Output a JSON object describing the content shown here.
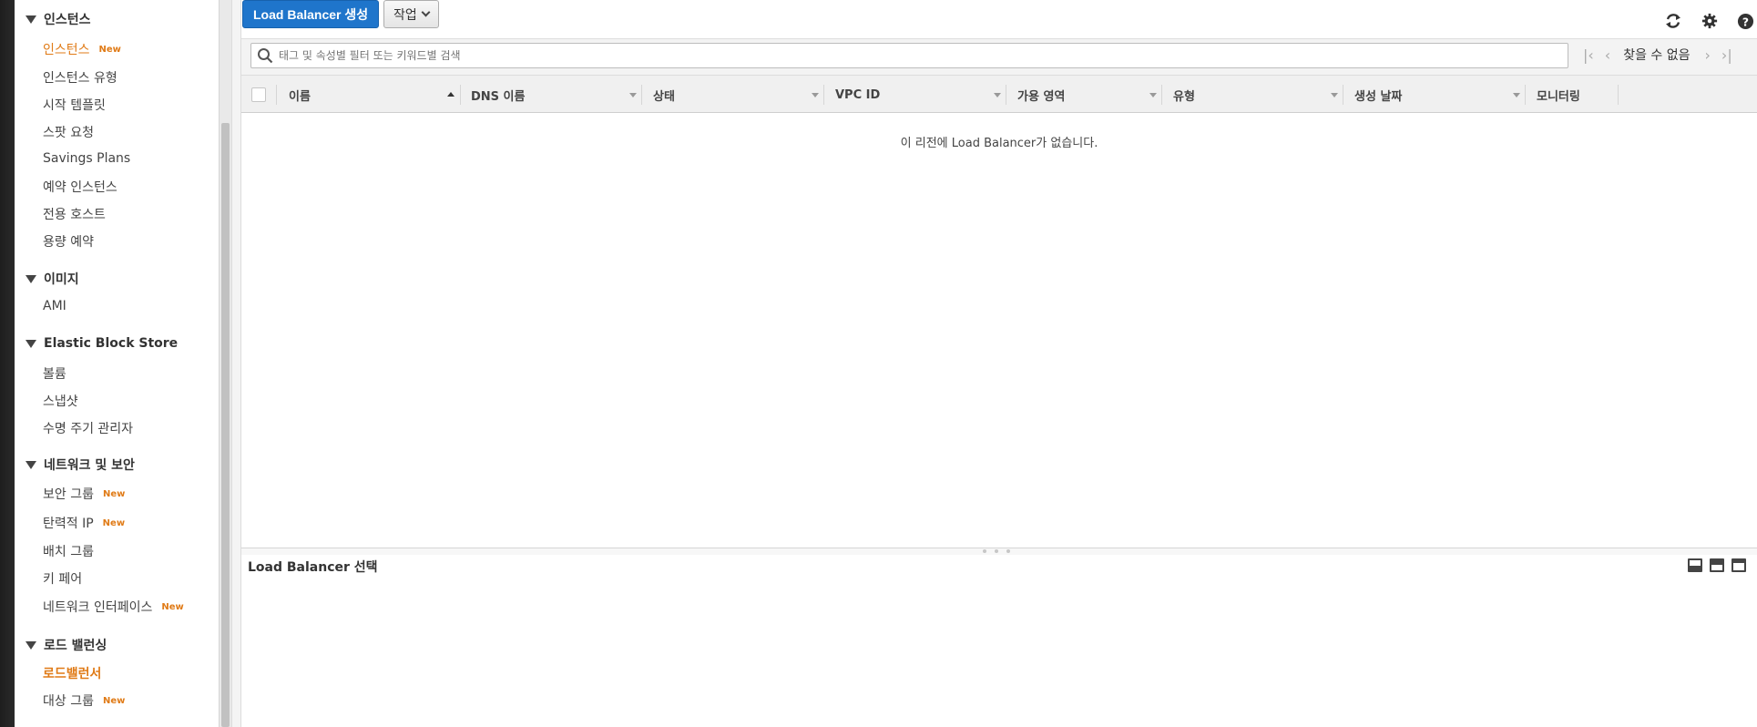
{
  "sidebar": {
    "sections": [
      {
        "title": "인스턴스",
        "items": [
          {
            "label": "인스턴스",
            "badge": "New",
            "state": "active"
          },
          {
            "label": "인스턴스 유형"
          },
          {
            "label": "시작 템플릿"
          },
          {
            "label": "스팟 요청"
          },
          {
            "label": "Savings Plans"
          },
          {
            "label": "예약 인스턴스"
          },
          {
            "label": "전용 호스트"
          },
          {
            "label": "용량 예약"
          }
        ]
      },
      {
        "title": "이미지",
        "items": [
          {
            "label": "AMI"
          }
        ]
      },
      {
        "title": "Elastic Block Store",
        "items": [
          {
            "label": "볼륨"
          },
          {
            "label": "스냅샷"
          },
          {
            "label": "수명 주기 관리자"
          }
        ]
      },
      {
        "title": "네트워크 및 보안",
        "items": [
          {
            "label": "보안 그룹",
            "badge": "New"
          },
          {
            "label": "탄력적 IP",
            "badge": "New"
          },
          {
            "label": "배치 그룹"
          },
          {
            "label": "키 페어"
          },
          {
            "label": "네트워크 인터페이스",
            "badge": "New"
          }
        ]
      },
      {
        "title": "로드 밸런싱",
        "items": [
          {
            "label": "로드밸런서",
            "state": "selected"
          },
          {
            "label": "대상 그룹",
            "badge": "New"
          }
        ]
      }
    ]
  },
  "toolbar": {
    "create_label": "Load Balancer 생성",
    "actions_label": "작업",
    "icons": [
      "refresh-icon",
      "gear-icon",
      "help-icon"
    ]
  },
  "search": {
    "placeholder": "태그 및 속성별 필터 또는 키워드별 검색"
  },
  "pagination": {
    "status": "찾을 수 없음"
  },
  "table": {
    "columns": [
      "이름",
      "DNS 이름",
      "상태",
      "VPC ID",
      "가용 영역",
      "유형",
      "생성 날짜",
      "모니터링"
    ],
    "sorted_column": "이름",
    "empty_message": "이 리전에 Load Balancer가 없습니다."
  },
  "detail": {
    "title": "Load Balancer 선택"
  },
  "colors": {
    "accent": "#e07b17",
    "primary": "#1f75cb"
  }
}
